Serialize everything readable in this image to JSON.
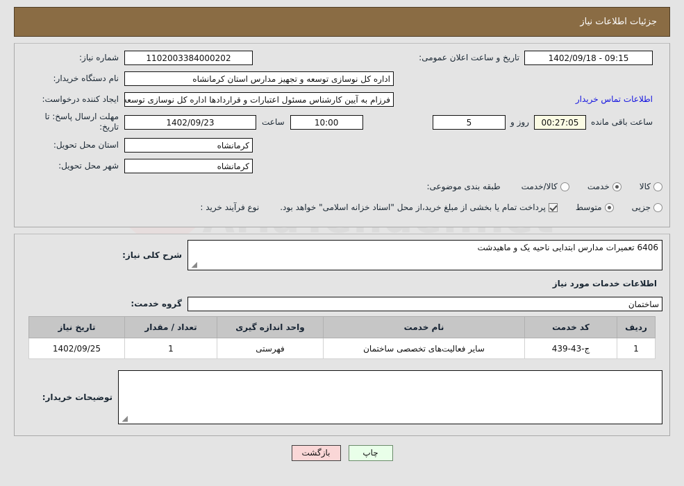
{
  "header": {
    "title": "جزئیات اطلاعات نیاز"
  },
  "form": {
    "need_number": {
      "label": "شماره نیاز:",
      "value": "1102003384000202"
    },
    "public_announce": {
      "label": "تاریخ و ساعت اعلان عمومی:",
      "value": "1402/09/18 - 09:15"
    },
    "buyer_org": {
      "label": "نام دستگاه خریدار:",
      "value": "اداره کل نوسازی  توسعه و تجهیز مدارس استان کرمانشاه"
    },
    "request_creator": {
      "label": "ایجاد کننده درخواست:",
      "value": "فرزام به آیین کارشناس مسئول اعتبارات و قراردادها اداره کل نوسازی  توسعه و ت"
    },
    "contact_link": {
      "label": "اطلاعات تماس خریدار"
    },
    "deadline": {
      "label": "مهلت ارسال پاسخ: تا تاریخ:",
      "date": "1402/09/23",
      "time_label": "ساعت",
      "time": "10:00",
      "days": "5",
      "days_label": "روز و",
      "timer": "00:27:05",
      "remaining_label": "ساعت باقی مانده"
    },
    "province": {
      "label": "استان محل تحویل:",
      "value": "کرمانشاه"
    },
    "city": {
      "label": "شهر محل تحویل:",
      "value": "کرمانشاه"
    },
    "category": {
      "label": "طبقه بندی موضوعی:",
      "options": [
        {
          "label": "کالا",
          "selected": false
        },
        {
          "label": "خدمت",
          "selected": true
        },
        {
          "label": "کالا/خدمت",
          "selected": false
        }
      ]
    },
    "purchase_type": {
      "label": "نوع فرآیند خرید :",
      "options": [
        {
          "label": "جزیی",
          "selected": false
        },
        {
          "label": "متوسط",
          "selected": true
        }
      ],
      "checkbox_note": "پرداخت تمام یا بخشی از مبلغ خرید،از محل \"اسناد خزانه اسلامی\" خواهد بود.",
      "checkbox_checked": true
    }
  },
  "need_summary": {
    "label": "شرح کلی نیاز:",
    "value": "6406 تعمیرات مدارس ابتدایی ناحیه یک و ماهیدشت"
  },
  "services_section": {
    "title": "اطلاعات خدمات مورد نیاز",
    "service_group": {
      "label": "گروه خدمت:",
      "value": "ساختمان"
    }
  },
  "table": {
    "columns": [
      "ردیف",
      "کد خدمت",
      "نام خدمت",
      "واحد اندازه گیری",
      "تعداد / مقدار",
      "تاریخ نیاز"
    ],
    "rows": [
      {
        "row_no": "1",
        "service_code": "ج-43-439",
        "service_name": "سایر فعالیت‌های تخصصی ساختمان",
        "unit": "فهرستی",
        "quantity": "1",
        "need_date": "1402/09/25"
      }
    ]
  },
  "buyer_notes": {
    "label": "توضیحات خریدار:",
    "value": ""
  },
  "buttons": {
    "back": "بازگشت",
    "print": "چاپ"
  },
  "watermark": {
    "text": "AriaTender.net"
  },
  "colors": {
    "header_bg": "#8a6c44",
    "page_bg": "#e4e4e4",
    "link": "#1414e0",
    "timer_bg": "#fbfbe4",
    "back_btn_bg": "#fad7d7",
    "print_btn_bg": "#e9ffe9",
    "table_header_bg": "#c6c6c6"
  }
}
